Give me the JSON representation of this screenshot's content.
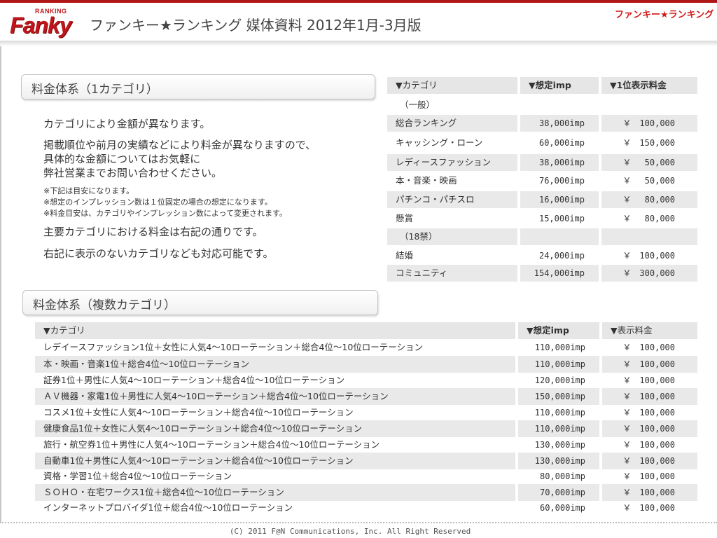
{
  "header": {
    "logo_small": "RANKING",
    "logo_big": "Fanky",
    "title": "ファンキー★ランキング 媒体資料 2012年1月-3月版",
    "brand_right": "ファンキー★ランキング"
  },
  "section1": {
    "title": "料金体系（1カテゴリ）",
    "line1": "カテゴリにより金額が異なります。",
    "line2": "掲載順位や前月の実績などにより料金が異なりますので、",
    "line3": "具体的な金額についてはお気軽に",
    "line4": "弊社営業までお問い合わせください。",
    "note1": "※下記は目安になります。",
    "note2": "※想定のインプレッション数は１位固定の場合の想定になります。",
    "note3": "※料金目安は、カテゴリやインプレッション数によって変更されます。",
    "line5": "主要カテゴリにおける料金は右記の通りです。",
    "line6": "右記に表示のないカテゴリなども対応可能です。"
  },
  "table1": {
    "headers": [
      "▼カテゴリ",
      "▼想定imp",
      "▼1位表示料金"
    ],
    "rows": [
      {
        "category": "（一般）",
        "imp": "",
        "price": ""
      },
      {
        "category": "総合ランキング",
        "imp": "38,000imp",
        "price": "￥　100,000"
      },
      {
        "category": "キャッシング・ローン",
        "imp": "60,000imp",
        "price": "￥　150,000"
      },
      {
        "category": "レディースファッション",
        "imp": "38,000imp",
        "price": "￥　 50,000"
      },
      {
        "category": "本・音楽・映画",
        "imp": "76,000imp",
        "price": "￥　 50,000"
      },
      {
        "category": "パチンコ・パチスロ",
        "imp": "16,000imp",
        "price": "￥　 80,000"
      },
      {
        "category": "懸賞",
        "imp": "15,000imp",
        "price": "￥　 80,000"
      },
      {
        "category": "（18禁）",
        "imp": "",
        "price": ""
      },
      {
        "category": "結婚",
        "imp": "24,000imp",
        "price": "￥　100,000"
      },
      {
        "category": "コミュニティ",
        "imp": "154,000imp",
        "price": "￥　300,000"
      }
    ]
  },
  "section2": {
    "title": "料金体系（複数カテゴリ）"
  },
  "table2": {
    "headers": [
      "▼カテゴリ",
      "▼想定imp",
      "▼表示料金"
    ],
    "rows": [
      {
        "category": "レデイースファッション1位＋女性に人気4～10ローテーション＋総合4位～10位ローテーション",
        "imp": "110,000imp",
        "price": "￥　100,000"
      },
      {
        "category": "本・映画・音楽1位＋総合4位～10位ローテーション",
        "imp": "110,000imp",
        "price": "￥　100,000"
      },
      {
        "category": "証券1位＋男性に人気4～10ローテーション＋総合4位～10位ローテーション",
        "imp": "120,000imp",
        "price": "￥　100,000"
      },
      {
        "category": "ＡＶ機器・家電1位＋男性に人気4～10ローテーション＋総合4位～10位ローテーション",
        "imp": "150,000imp",
        "price": "￥　100,000"
      },
      {
        "category": "コスメ1位＋女性に人気4～10ローテーション＋総合4位～10位ローテーション",
        "imp": "110,000imp",
        "price": "￥　100,000"
      },
      {
        "category": "健康食品1位＋女性に人気4～10ローテーション＋総合4位～10位ローテーション",
        "imp": "110,000imp",
        "price": "￥　100,000"
      },
      {
        "category": "旅行・航空券1位＋男性に人気4～10ローテーション＋総合4位～10位ローテーション",
        "imp": "130,000imp",
        "price": "￥　100,000"
      },
      {
        "category": "自動車1位＋男性に人気4～10ローテーション＋総合4位～10位ローテーション",
        "imp": "130,000imp",
        "price": "￥　100,000"
      },
      {
        "category": "資格・学習1位＋総合4位～10位ローテーション",
        "imp": "80,000imp",
        "price": "￥　100,000"
      },
      {
        "category": "ＳＯＨＯ・在宅ワークス1位＋総合4位～10位ローテーション",
        "imp": "70,000imp",
        "price": "￥　100,000"
      },
      {
        "category": "インターネットプロバイダ1位＋総合4位～10位ローテーション",
        "imp": "60,000imp",
        "price": "￥　100,000"
      }
    ]
  },
  "footer": {
    "copyright": "(C) 2011 F@N Communications, Inc. All Right Reserved"
  }
}
